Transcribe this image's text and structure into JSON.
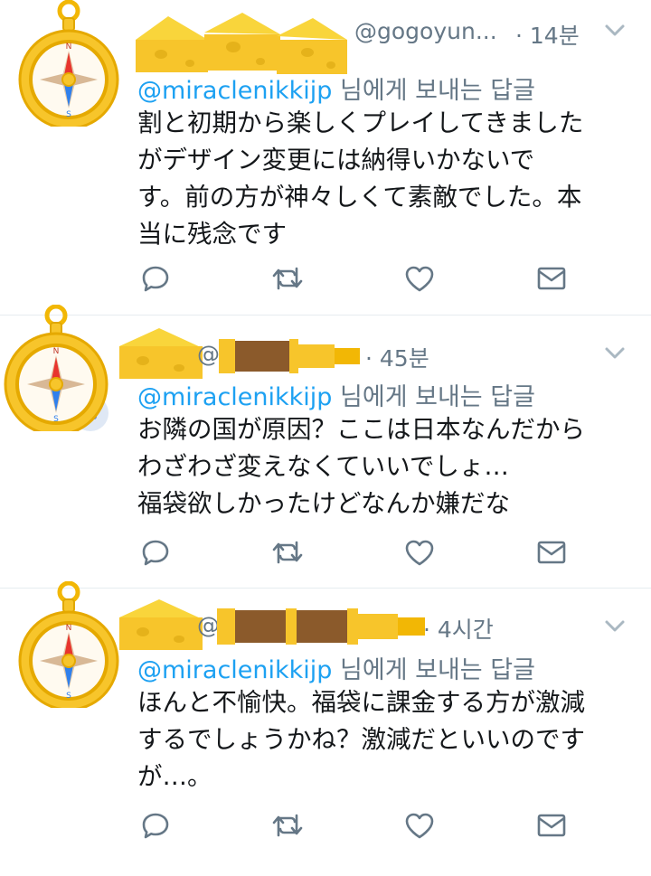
{
  "tweets": [
    {
      "handle": "@gogoyun...",
      "time": "· 14분",
      "reply_mention": "@miraclenikkijp",
      "reply_suffix": " 님에게 보내는 답글",
      "lines": [
        "割と初期から楽しくプレイしてきました",
        "がデザイン変更には納得いかないで",
        "す。前の方が神々しくて素敵でした。本",
        "当に残念です"
      ]
    },
    {
      "handle": "@",
      "time": "· 45분",
      "reply_mention": "@miraclenikkijp",
      "reply_suffix": " 님에게 보내는 답글",
      "lines": [
        "お隣の国が原因？ここは日本なんだから",
        "わざわざ変えなくていいでしょ…",
        "福袋欲しかったけどなんか嫌だな"
      ]
    },
    {
      "handle": "@",
      "time": "· 4시간",
      "reply_mention": "@miraclenikkijp",
      "reply_suffix": " 님에게 보내는 답글",
      "lines": [
        "ほんと不愉快。福袋に課金する方が激減",
        "するでしょうかね？激減だといいのです",
        "が…。"
      ]
    }
  ],
  "icons": {
    "avatar": "compass-icon",
    "reply": "reply-icon",
    "retweet": "retweet-icon",
    "like": "heart-icon",
    "dm": "envelope-icon",
    "menu": "chevron-down-icon",
    "name_mask": "cheese-sticker",
    "handle_mask": "telescope-sticker"
  },
  "colors": {
    "mention": "#1da1f2",
    "secondary": "#657786",
    "text": "#14171a",
    "divider": "#e6ecf0",
    "compass_gold": "#f7c52b"
  }
}
